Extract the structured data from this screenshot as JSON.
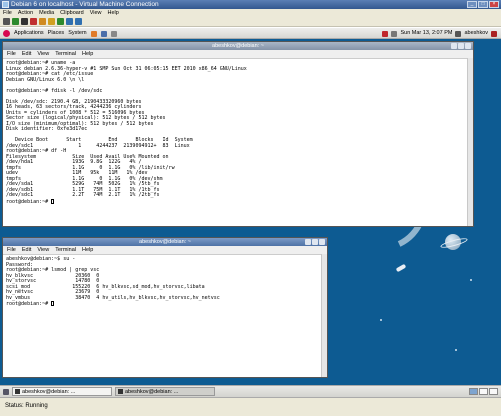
{
  "window": {
    "title": "Debian 6 on localhost - Virtual Machine Connection"
  },
  "host_menu": [
    "File",
    "Action",
    "Media",
    "Clipboard",
    "View",
    "Help"
  ],
  "host_toolbar": [
    {
      "icon": "ctrl-alt-del-icon",
      "color": "#555555"
    },
    {
      "icon": "start-icon",
      "color": "#2d8a2d"
    },
    {
      "icon": "turn-off-icon",
      "color": "#333333"
    },
    {
      "icon": "shutdown-icon",
      "color": "#c03030"
    },
    {
      "icon": "save-icon",
      "color": "#d08a20"
    },
    {
      "icon": "pause-icon",
      "color": "#d0a020"
    },
    {
      "icon": "reset-icon",
      "color": "#2d8a2d"
    },
    {
      "icon": "snapshot-icon",
      "color": "#3070b0"
    },
    {
      "icon": "revert-icon",
      "color": "#3070b0"
    }
  ],
  "gnome_panel": {
    "menus": [
      "Applications",
      "Places",
      "System"
    ],
    "clock": "Sun Mar 13,  2:07 PM",
    "user": "abeshkov"
  },
  "terminal1": {
    "title": "abeshkov@debian: ~",
    "menu": [
      "File",
      "Edit",
      "View",
      "Terminal",
      "Help"
    ],
    "lines": [
      "root@debian:~# uname -a",
      "Linux debian 2.6.36-hyper-v #1 SMP Sun Oct 31 06:05:15 EET 2010 x86_64 GNU/Linux",
      "root@debian:~# cat /etc/issue",
      "Debian GNU/Linux 6.0 \\n \\l",
      "",
      "root@debian:~# fdisk -l /dev/sdc",
      "",
      "Disk /dev/sdc: 2190.4 GB, 2190433320960 bytes",
      "16 heads, 63 sectors/track, 4244236 cylinders",
      "Units = cylinders of 1008 * 512 = 516096 bytes",
      "Sector size (logical/physical): 512 bytes / 512 bytes",
      "I/O size (minimum/optimal): 512 bytes / 512 bytes",
      "Disk identifier: 0xfe3d17ec",
      "",
      "   Device Boot      Start         End      Blocks   Id  System",
      "/dev/sdc1               1     4244237  2139094912+  83  Linux",
      "root@debian:~# df -H",
      "Filesystem            Size  Used Avail Use% Mounted on",
      "/dev/hda1             193G  9.8G  122G   4% /",
      "tmpfs                 1.1G     0  1.1G   0% /lib/init/rw",
      "udev                  11M   95k   11M   1% /dev",
      "tmpfs                 1.1G     0  1.1G   0% /dev/shm",
      "/dev/sda1             529G   74M  502G   1% /5tb_fs",
      "/dev/sdb1             1.1T   75M  1.1T   1% /1tb_fs",
      "/dev/sdc1             2.2T   74M  2.1T   1% /2tb_fs"
    ],
    "prompt": "root@debian:~# "
  },
  "terminal2": {
    "title": "abeshkov@debian: ~",
    "menu": [
      "File",
      "Edit",
      "View",
      "Terminal",
      "Help"
    ],
    "lines": [
      "abeshkov@debian:~$ su -",
      "Password:",
      "root@debian:~# lsmod | grep vsc",
      "hv_blkvsc              20360  0",
      "hv_storvsc             14780  0",
      "scsi_mod              155220  6 hv_blkvsc,sd_mod,hv_storvsc,libata",
      "hv_netvsc              23679  0",
      "hv_vmbus               38470  4 hv_utils,hv_blkvsc,hv_storvsc,hv_netvsc"
    ],
    "prompt": "root@debian:~# "
  },
  "taskbar": {
    "items": [
      "abeshkov@debian: ...",
      "abeshkov@debian: ..."
    ]
  },
  "status": {
    "text": "Status: Running"
  }
}
